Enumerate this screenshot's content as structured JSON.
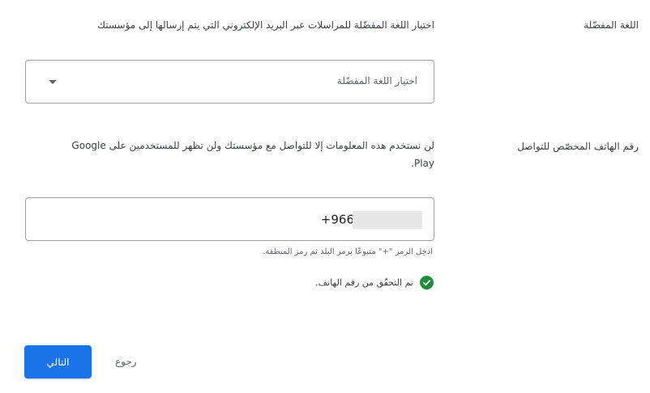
{
  "language_section": {
    "label": "اللغة المفضّلة",
    "description": "اختيار اللغة المفضّلة للمراسلات عبر البريد الإلكتروني التي يتم إرسالها إلى مؤسستك",
    "select_placeholder": "اختيار اللغة المفضّلة"
  },
  "phone_section": {
    "label": "رقم الهاتف المخصّص للتواصل",
    "description_line1": "لن نستخدم هذه المعلومات إلا للتواصل مع مؤسستك ولن تظهر للمستخدمين على Google",
    "description_line2": "Play.",
    "phone_value_prefix": "+966",
    "hint": "ادخِل الرمز \"+\" متبوعًا برمز البلد ثم رمز المنطقة.",
    "verified_text": "تم التحقّق من رقم الهاتف."
  },
  "actions": {
    "next_label": "التالي",
    "back_label": "رجوع"
  },
  "colors": {
    "primary": "#1a73e8",
    "success": "#1e8e3e"
  }
}
